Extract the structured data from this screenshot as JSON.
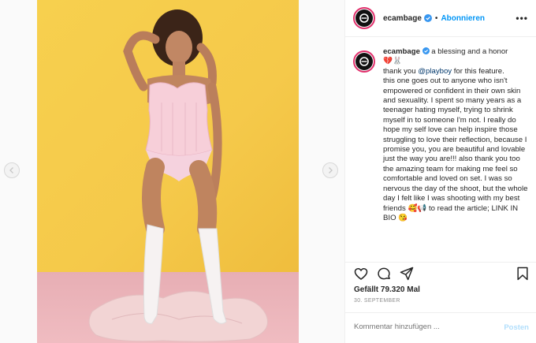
{
  "post": {
    "username": "ecambage",
    "follow_label": "Abonnieren",
    "separator": "•",
    "more_label": "•••",
    "caption_username": "ecambage",
    "caption_lines": [
      "a blessing and a honor",
      "💔🐰",
      "thank you",
      "@playboy",
      "for this feature.",
      "this one goes out to anyone who isn't empowered or confident in their own skin and sexuality. I spent so many years as a teenager hating myself, trying to shrink myself in to someone I'm not. I really do hope my self love can help inspire those struggling to love their reflection, because I promise you, you are beautiful and lovable just the way you are!!! also thank you too the amazing team for making me feel so comfortable and loved on set. I was so nervous the day of the shoot, but the whole day I felt like I was shooting with my best friends 🥰📢 to read the article; LINK IN BIO 😘"
    ],
    "likes_text": "Gefällt 79.320 Mal",
    "date_text": "30. SEPTEMBER",
    "comment_placeholder": "Kommentar hinzufügen ...",
    "post_button": "Posten"
  },
  "colors": {
    "follow": "#0095f6",
    "mention": "#00376b",
    "post_disabled": "#b2dffc",
    "wall": "#f5c94a",
    "floor": "#eeb6bc"
  },
  "icons": [
    "chevron-left-icon",
    "chevron-right-icon",
    "verified-icon",
    "heart-icon",
    "comment-icon",
    "share-icon",
    "bookmark-icon"
  ]
}
